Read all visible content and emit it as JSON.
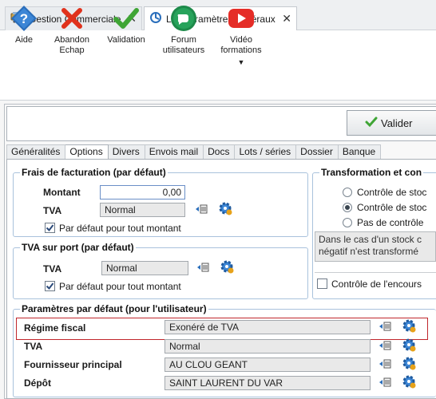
{
  "tabs": {
    "app1": "Gestion Commerciale",
    "app2": "Les paramètres généraux"
  },
  "ribbon": {
    "aide": "Aide",
    "abandon_1": "Abandon",
    "abandon_2": "Echap",
    "validation": "Validation",
    "forum_1": "Forum",
    "forum_2": "utilisateurs",
    "video_1": "Vidéo",
    "video_2": "formations"
  },
  "actions": {
    "valider": "Valider"
  },
  "sections": [
    "Généralités",
    "Options",
    "Divers",
    "Envois mail",
    "Docs",
    "Lots / séries",
    "Dossier",
    "Banque"
  ],
  "frais": {
    "title": "Frais de facturation (par défaut)",
    "montant_label": "Montant",
    "montant_value": "0,00",
    "tva_label": "TVA",
    "tva_value": "Normal",
    "check_label": "Par défaut pour tout montant"
  },
  "port": {
    "title": "TVA sur port (par défaut)",
    "tva_label": "TVA",
    "tva_value": "Normal",
    "check_label": "Par défaut pour tout montant"
  },
  "transfo": {
    "title": "Transformation et con",
    "r1": "Contrôle de stoc",
    "r2": "Contrôle de stoc",
    "r3": "Pas de contrôle",
    "info_1": "Dans le cas d'un stock c",
    "info_2": "négatif n'est transformé",
    "encours": "Contrôle de l'encours"
  },
  "params": {
    "title": "Paramètres par défaut (pour l'utilisateur)",
    "regime_label": "Régime fiscal",
    "regime_value": "Exonéré de TVA",
    "tva_label": "TVA",
    "tva_value": "Normal",
    "fourn_label": "Fournisseur principal",
    "fourn_value": "AU CLOU GEANT",
    "depot_label": "Dépôt",
    "depot_value": "SAINT LAURENT DU VAR"
  },
  "colors": {
    "accent_blue": "#2a6ebb",
    "abandon_red": "#e0321c",
    "valid_green": "#3fa535",
    "youtube_red": "#e52d27",
    "highlight_red": "#c0262c"
  }
}
